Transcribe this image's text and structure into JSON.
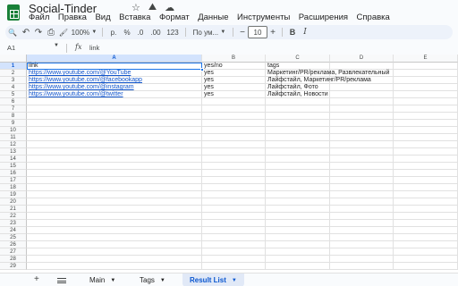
{
  "app": {
    "title": "Social-Tinder",
    "icons": [
      "star-icon",
      "move-to-folder-icon",
      "cloud-status-icon"
    ]
  },
  "menu": [
    "Файл",
    "Правка",
    "Вид",
    "Вставка",
    "Формат",
    "Данные",
    "Инструменты",
    "Расширения",
    "Справка"
  ],
  "toolbar": {
    "search_glyph": "🔍",
    "undo_glyph": "↶",
    "redo_glyph": "↷",
    "print_glyph": "⎙",
    "paint_glyph": "🖌",
    "zoom": "100%",
    "currency": "р.",
    "percent": "%",
    "dec_decrease": ".0",
    "dec_increase": ".00",
    "number_format": "123",
    "font": "По ум...",
    "minus": "−",
    "font_size": "10",
    "plus": "+",
    "bold": "B",
    "italic": "I"
  },
  "formula_bar": {
    "cell_ref": "A1",
    "fx": "fx",
    "value": "link"
  },
  "columns": [
    "A",
    "B",
    "C",
    "D",
    "E"
  ],
  "active_column": "A",
  "rows": [
    [
      "link",
      "yes/no",
      "tags"
    ],
    [
      "https://www.youtube.com/@YouTube",
      "yes",
      "Маркетинг/PR/реклама, Развлекательный"
    ],
    [
      "https://www.youtube.com/@facebookapp",
      "yes",
      "Лайфстайл, Маркетинг/PR/реклама"
    ],
    [
      "https://www.youtube.com/@instagram",
      "yes",
      "Лайфстайл, Фото"
    ],
    [
      "https://www.youtube.com/@twitter",
      "yes",
      "Лайфстайл, Новости"
    ]
  ],
  "row_count": 29,
  "sheets": [
    {
      "label": "Main",
      "active": false
    },
    {
      "label": "Tags",
      "active": false
    },
    {
      "label": "Result List",
      "active": true
    }
  ],
  "colors": {
    "accent": "#1a73e8",
    "link": "#1155cc",
    "brand": "#188038"
  }
}
